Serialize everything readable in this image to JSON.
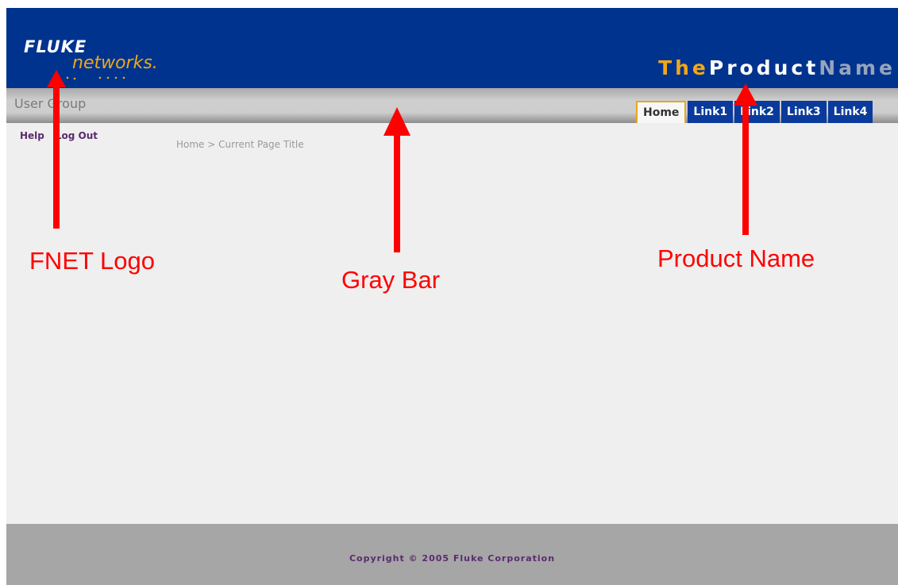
{
  "brand": {
    "logo_line1": "FLUKE",
    "logo_line2": "networks.",
    "colors": {
      "header_blue": "#00338e",
      "accent_gold": "#f0a818",
      "annotation_red": "#ff0000"
    }
  },
  "product_name": {
    "part1": "The",
    "part2": "Product",
    "part3": "Name"
  },
  "graybar": {
    "user_group": "User Group"
  },
  "tabs": [
    {
      "label": "Home",
      "active": true
    },
    {
      "label": "Link1",
      "active": false
    },
    {
      "label": "Link2",
      "active": false
    },
    {
      "label": "Link3",
      "active": false
    },
    {
      "label": "Link4",
      "active": false
    }
  ],
  "util_links": {
    "help": "Help",
    "logout": "Log Out"
  },
  "breadcrumb": "Home > Current Page Title",
  "footer": {
    "copyright": "Copyright © 2005 Fluke Corporation"
  },
  "annotations": {
    "logo": "FNET Logo",
    "gray_bar": "Gray Bar",
    "product_name": "Product Name"
  },
  "icons": [
    "arrow-up-icon",
    "logo-dots-icon"
  ]
}
